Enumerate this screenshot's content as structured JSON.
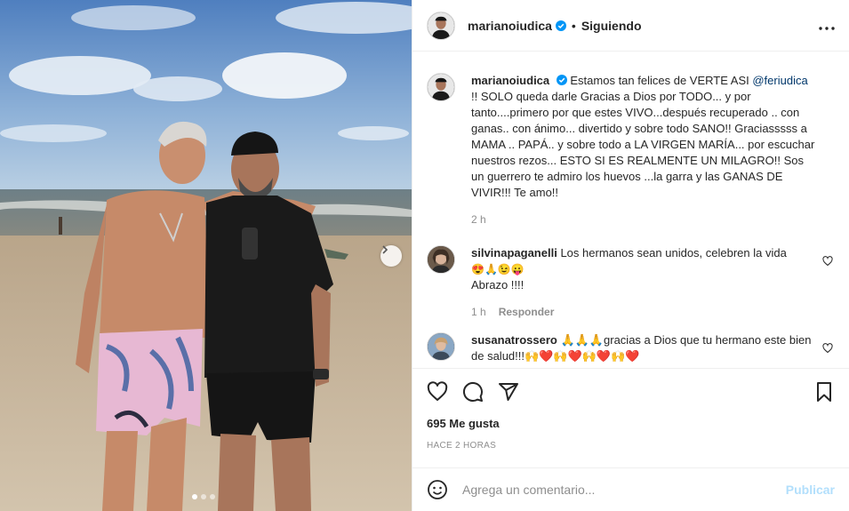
{
  "post": {
    "username": "marianoiudica",
    "follow_status": "Siguiendo",
    "separator": "•",
    "more_label": "•••",
    "photo_dots": 3,
    "caption": {
      "username": "marianoiudica",
      "part1": "Estamos tan felices de VERTE ASI ",
      "mention": "@feriudica",
      "part2": " !! SOLO queda darle Gracias a Dios por TODO... y por tanto....primero por que estes VIVO...después recuperado .. con ganas.. con ánimo... divertido y sobre todo SANO!! Graciasssss a MAMA .. PAPÁ.. y sobre todo a LA VIRGEN MARÍA... por escuchar nuestros rezos... ESTO SI ES REALMENTE UN MILAGRO!! Sos un guerrero te admiro los huevos ...la garra y las GANAS DE VIVIR!!! Te amo!!",
      "time": "2 h"
    },
    "comments": [
      {
        "username": "silvinapaganelli",
        "text_line1": "Los hermanos sean unidos, celebren la vida",
        "emoji_line": "😍🙏😉😛",
        "text_line3": "Abrazo !!!!",
        "time": "1 h",
        "reply_label": "Responder"
      },
      {
        "username": "susanatrossero",
        "text": "🙏🙏🙏gracias a Dios que tu hermano este bien de salud!!!🙌❤️🙌❤️🙌❤️🙌❤️"
      }
    ],
    "likes": "695 Me gusta",
    "posted_ago": "HACE 2 HORAS",
    "comment_placeholder": "Agrega un comentario...",
    "publish_label": "Publicar"
  },
  "colors": {
    "verified": "#0095f6",
    "mention": "#00376b",
    "publish": "#b2dffc",
    "secondary_text": "#8e8e8e"
  },
  "icons": [
    "verified-icon",
    "more-icon",
    "heart-icon",
    "comment-icon",
    "share-icon",
    "bookmark-icon",
    "emoji-icon",
    "chevron-right-icon"
  ]
}
